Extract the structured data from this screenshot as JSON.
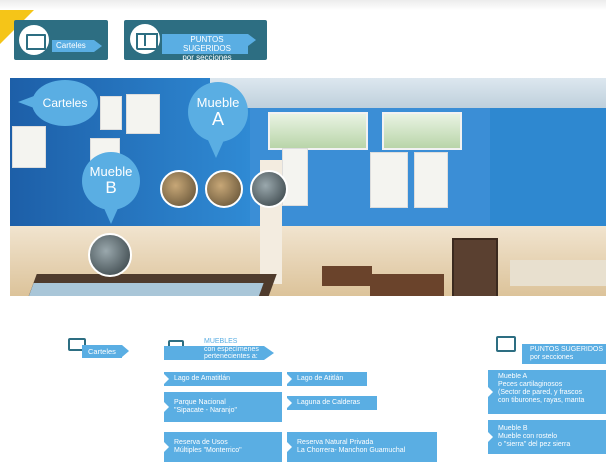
{
  "header": {
    "carteles_label": "Carteles",
    "puntos_line1": "PUNTOS SUGERIDOS",
    "puntos_line2": "por secciones"
  },
  "photo": {
    "bubble_carteles": "Carteles",
    "bubble_mueble_a_1": "Mueble",
    "bubble_mueble_a_2": "A",
    "bubble_mueble_b_1": "Mueble",
    "bubble_mueble_b_2": "B"
  },
  "bottom": {
    "carteles_label": "Carteles",
    "muebles_title": "MUEBLES",
    "muebles_sub1": "con especímenes",
    "muebles_sub2": "pertenecientes a:",
    "puntos_line1": "PUNTOS SUGERIDOS",
    "puntos_line2": "por secciones",
    "locations": [
      "Lago de Amatitlán",
      "Lago de Atitlán",
      "Parque Nacional\n\"Sipacate - Naranjo\"",
      "Laguna de Calderas",
      "Reserva de Usos\nMúltiples \"Monterrico\"",
      "Reserva Natural Privada\nLa Chorrera- Manchon Guamuchal"
    ],
    "points": [
      "Mueble A\nPeces cartilaginosos\n(Sector de pared, y frascos\ncon tiburones, rayas, manta",
      "Mueble B\nMueble con rostelo\no \"sierra\" del pez sierra"
    ]
  },
  "colors": {
    "accent": "#5aaee3",
    "dark_teal": "#2d6e82",
    "yellow": "#f5c518"
  }
}
